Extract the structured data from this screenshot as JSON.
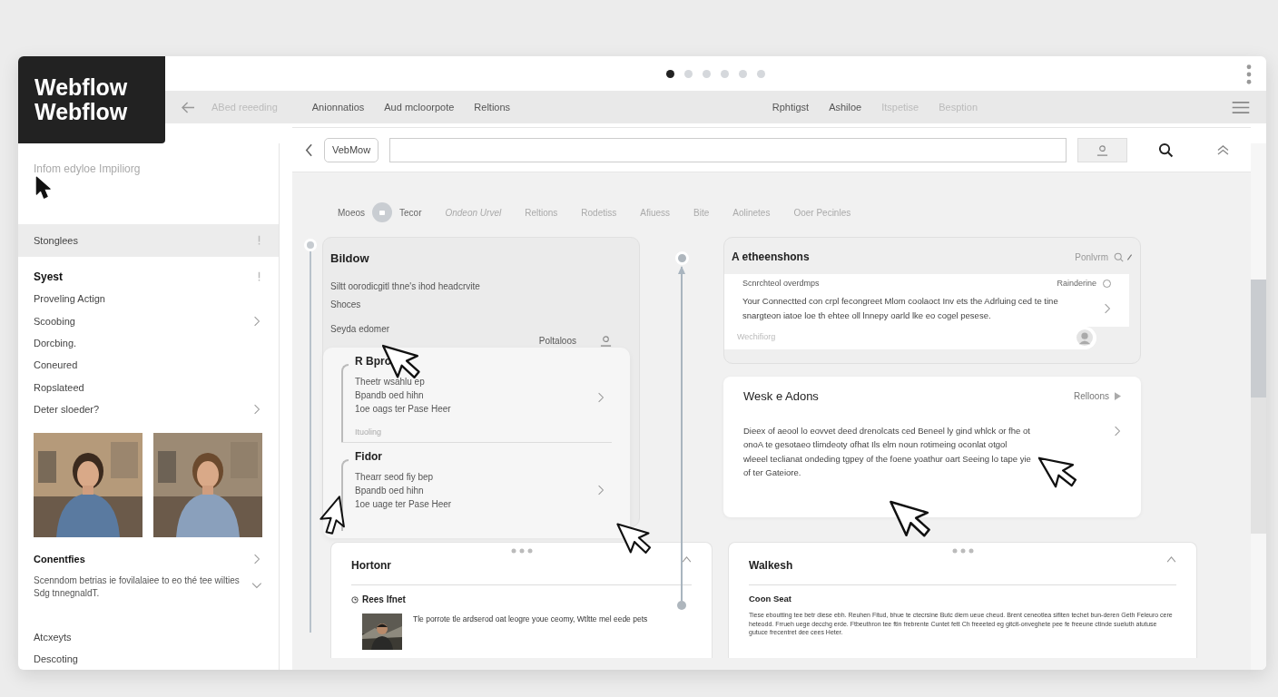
{
  "logo": {
    "lines": [
      "Webflow",
      "Webflow"
    ]
  },
  "pager": {
    "dots": [
      {
        "selected": true
      },
      {
        "selected": false
      },
      {
        "selected": false
      },
      {
        "selected": false
      },
      {
        "selected": false
      },
      {
        "selected": false
      }
    ]
  },
  "nav": {
    "back_label": "ABed reeeding",
    "left_items": [
      {
        "label": "Anionnatios",
        "disabled": false
      },
      {
        "label": "Aud mcloorpote",
        "disabled": false
      },
      {
        "label": "Reltions",
        "disabled": false
      }
    ],
    "right_items": [
      {
        "label": "Rphtigst",
        "disabled": false
      },
      {
        "label": "Ashiloe",
        "disabled": false
      },
      {
        "label": "Itspetise",
        "disabled": true
      },
      {
        "label": "Besption",
        "disabled": true
      }
    ]
  },
  "sidebar": {
    "hint": "Infom edyloe Impiliorg",
    "items": [
      {
        "label": "Stonglees",
        "selected": true,
        "bold": false,
        "kind": "menu"
      },
      {
        "label": "Syest",
        "selected": false,
        "bold": true,
        "kind": "menu"
      },
      {
        "label": "Proveling Actign",
        "selected": false,
        "bold": false,
        "kind": "plain"
      },
      {
        "label": "Scoobing",
        "selected": false,
        "bold": false,
        "kind": "submenu"
      },
      {
        "label": "Dorcbing.",
        "selected": false,
        "bold": false,
        "kind": "plain"
      },
      {
        "label": "Coneured",
        "selected": false,
        "bold": false,
        "kind": "plain"
      },
      {
        "label": "Ropslateed",
        "selected": false,
        "bold": false,
        "kind": "plain"
      },
      {
        "label": "Deter sloeder?",
        "selected": false,
        "bold": false,
        "kind": "submenu"
      }
    ],
    "section": {
      "title": "Conentfies",
      "description": "Scenndom betrias ie fovilalaiee to eo thé tee wilties Sdg tnnegnaldT."
    },
    "more_items": [
      {
        "label": "Atcxeyts",
        "selected": false
      },
      {
        "label": "Descoting",
        "selected": false
      }
    ]
  },
  "toolbar": {
    "chip": "VebMow"
  },
  "tabs": [
    {
      "label": "Moeos",
      "selected": false
    },
    {
      "label": "Tecor",
      "selected": true
    },
    {
      "label": "Ondeon Urvel",
      "selected": false
    },
    {
      "label": "Reltions",
      "selected": false
    },
    {
      "label": "Rodetiss",
      "selected": false
    },
    {
      "label": "Afiuess",
      "selected": false
    },
    {
      "label": "Bite",
      "selected": false
    },
    {
      "label": "Aolinetes",
      "selected": false
    },
    {
      "label": "Ooer Pecinles",
      "selected": false
    }
  ],
  "left_panel": {
    "title": "Bildow",
    "lines": [
      "Siltt oorodicgitl thne's ihod headcrvite",
      "Shoces"
    ],
    "subtitle": "Seyda edomer",
    "subtab": "Poltaloos",
    "items": [
      {
        "title": "R Bpro",
        "lines": [
          "Theetr wsahlu ep",
          "Bpandb oed hihn",
          "1oe oags ter Pase Heer"
        ],
        "footer": "Ituoling"
      },
      {
        "title": "Fidor",
        "lines": [
          "Thearr seod fiy bep",
          "Bpandb oed hihn",
          "1oe uage ter Pase Heer"
        ]
      }
    ]
  },
  "right_panel": {
    "title": "A etheenshons",
    "action": "Ponlvrm",
    "card": {
      "title": "Scnrchteol overdmps",
      "option": "Rainderine",
      "checked": false,
      "text": "Your Connectted con crpl fecongreet Mlom coolaoct Inv ets the Adrluing ced te tine snargteon iatoe loe th ehtee oll lnnepy oarld lke eo cogel pesese."
    },
    "field": {
      "placeholder": "Wechifiorg"
    },
    "feature": {
      "title": "Wesk e Adons",
      "action": "Relloons",
      "text": "Dieex of aeool lo eovvet deed drenolcats ced Beneel ly gind whlck or fhe ot onoA te gesotaeo tlimdeoty ofhat Ils elm noun rotimeing oconlat otgol wleeel teclianat ondeding tgpey of the foene yoathur oart Seeing lo tape yie of ter Gateiore."
    }
  },
  "bottom_cards": [
    {
      "title": "Hortonr",
      "subtitle": "Rees Ifnet",
      "text": "Tle porrote tle ardserod oat leogre youe ceomy, Wtltte mel eede pets",
      "kind": "media"
    },
    {
      "title": "Walkesh",
      "subtitle": "Coon Seat",
      "text": "Tiese eboutting tee betr diese ebh. Reuhen Fitud, bhue te ctecrsine Butc diem ueue cheud. Brent ceneotlea sifiten techet bun-deren Geth Feleuro cere heteodd. Frrueh uege decchg erde. Ftbeuthron tee ftin frebrente Cuntet fett Ch freeeted eg gitcit-onveghete pee fe freeune ctinde sueluth atutuse gutuce frecentret dee cees Heter.",
      "kind": "text"
    }
  ]
}
